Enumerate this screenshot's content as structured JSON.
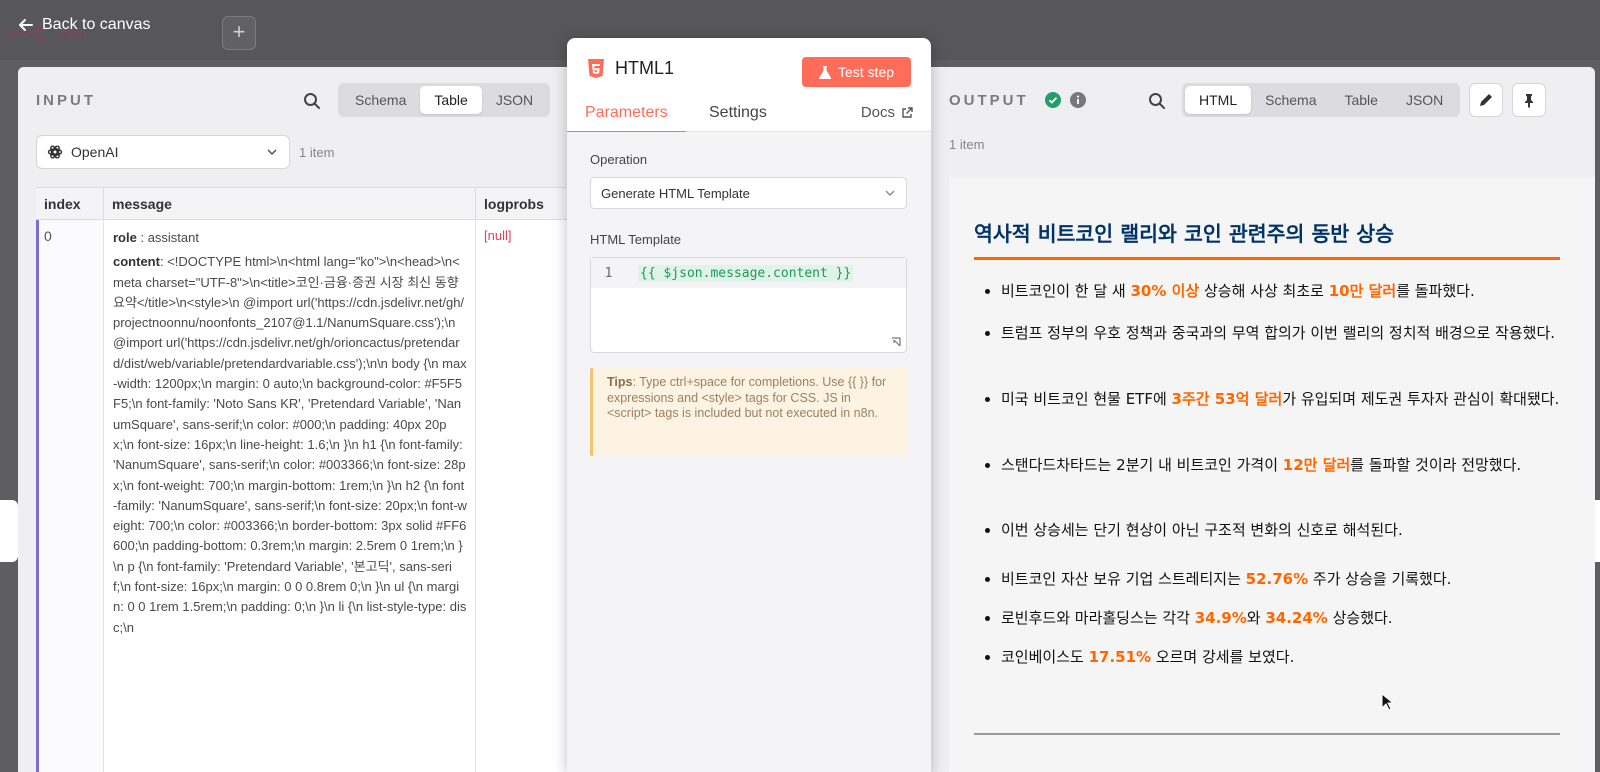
{
  "topbar": {
    "back_label": "Back to canvas",
    "logo_text": "n8n",
    "plus": "+"
  },
  "input": {
    "title": "INPUT",
    "tabs": [
      "Schema",
      "Table",
      "JSON"
    ],
    "active_tab": "Table",
    "source_select": "OpenAI",
    "item_count": "1 item",
    "columns": [
      "index",
      "message",
      "logprobs"
    ],
    "row": {
      "index": "0",
      "role_key": "role",
      "role_val": ": assistant",
      "content_key": "content",
      "content_val": ": <!DOCTYPE html>\\n<html lang=\"ko\">\\n<head>\\n<meta charset=\"UTF-8\">\\n<title>코인·금융·증권 시장 최신 동향 요약</title>\\n<style>\\n  @import url('https://cdn.jsdelivr.net/gh/projectnoonnu/noonfonts_2107@1.1/NanumSquare.css');\\n  @import url('https://cdn.jsdelivr.net/gh/orioncactus/pretendard/dist/web/variable/pretendardvariable.css');\\n\\n  body {\\n    max-width: 1200px;\\n    margin: 0 auto;\\n    background-color: #F5F5F5;\\n    font-family: 'Noto Sans KR', 'Pretendard Variable', 'NanumSquare', sans-serif;\\n    color: #000;\\n    padding: 40px 20px;\\n    font-size: 16px;\\n    line-height: 1.6;\\n  }\\n  h1 {\\n    font-family: 'NanumSquare', sans-serif;\\n    color: #003366;\\n    font-size: 28px;\\n    font-weight: 700;\\n    margin-bottom: 1rem;\\n  }\\n  h2 {\\n    font-family: 'NanumSquare', sans-serif;\\n    font-size: 20px;\\n    font-weight: 700;\\n    color: #003366;\\n    border-bottom: 3px solid #FF6600;\\n    padding-bottom: 0.3rem;\\n    margin: 2.5rem 0 1rem;\\n  }\\n  p {\\n    font-family: 'Pretendard Variable', '본고딕', sans-serif;\\n    font-size: 16px;\\n    margin: 0 0 0.8rem 0;\\n  }\\n  ul {\\n    margin: 0 0 1rem 1.5rem;\\n    padding: 0;\\n  }\\n  li {\\n    list-style-type: disc;\\n",
      "logprobs": "[null]"
    }
  },
  "node": {
    "title": "HTML1",
    "test_button": "Test step",
    "tabs": {
      "parameters": "Parameters",
      "settings": "Settings",
      "docs": "Docs"
    },
    "operation_label": "Operation",
    "operation_value": "Generate HTML Template",
    "template_label": "HTML Template",
    "line_number": "1",
    "template_value": "{{ $json.message.content }}",
    "tips": {
      "lead": "Tips",
      "text": ": Type ctrl+space for completions. Use {{ }} for expressions and <style> tags for CSS. JS in <script> tags is included but not executed in n8n."
    }
  },
  "output": {
    "title": "OUTPUT",
    "tabs": [
      "HTML",
      "Schema",
      "Table",
      "JSON"
    ],
    "active_tab": "HTML",
    "item_count": "1 item",
    "doc": {
      "heading": "역사적 비트코인 랠리와 코인 관련주의 동반 상승",
      "bullets": [
        {
          "parts": [
            {
              "t": "비트코인이 한 달 새 "
            },
            {
              "t": "30% 이상",
              "hl": true
            },
            {
              "t": " 상승해 사상 최초로 "
            },
            {
              "t": "10만 달러",
              "hl": true
            },
            {
              "t": "를 돌파했다."
            }
          ]
        },
        {
          "parts": [
            {
              "t": "트럼프 정부의 우호 정책과 중국과의 무역 합의가 이번 랠리의 정치적 배경으로 작용했다."
            }
          ]
        },
        {
          "parts": [
            {
              "t": "미국 비트코인 현물 ETF에 "
            },
            {
              "t": "3주간 53억 달러",
              "hl": true
            },
            {
              "t": "가 유입되며 제도권 투자자 관심이 확대됐다."
            }
          ]
        },
        {
          "parts": [
            {
              "t": "스탠다드차타드는 2분기 내 비트코인 가격이 "
            },
            {
              "t": "12만 달러",
              "hl": true
            },
            {
              "t": "를 돌파할 것이라 전망했다."
            }
          ]
        },
        {
          "parts": [
            {
              "t": "이번 상승세는 단기 현상이 아닌 구조적 변화의 신호로 해석된다."
            }
          ]
        },
        {
          "parts": [
            {
              "t": "비트코인 자산 보유 기업 스트레티지는 "
            },
            {
              "t": "52.76%",
              "hl": true
            },
            {
              "t": " 주가 상승을 기록했다."
            }
          ]
        },
        {
          "parts": [
            {
              "t": "로빈후드와 마라홀딩스는 각각 "
            },
            {
              "t": "34.9%",
              "hl": true
            },
            {
              "t": "와 "
            },
            {
              "t": "34.24%",
              "hl": true
            },
            {
              "t": " 상승했다."
            }
          ]
        },
        {
          "parts": [
            {
              "t": "코인베이스도 "
            },
            {
              "t": "17.51%",
              "hl": true
            },
            {
              "t": " 오르며 강세를 보였다."
            }
          ]
        }
      ]
    }
  },
  "colors": {
    "accent": "#ff6d5a",
    "heading_blue": "#003366",
    "highlight": "#ff6600",
    "success": "#22a06b"
  },
  "icons": [
    "arrow-left-icon",
    "plus-icon",
    "search-icon",
    "openai-icon",
    "chevron-down-icon",
    "html5-icon",
    "flask-icon",
    "external-link-icon",
    "resize-icon",
    "check-circle-icon",
    "info-icon",
    "pencil-icon",
    "pin-icon",
    "cursor-icon"
  ]
}
